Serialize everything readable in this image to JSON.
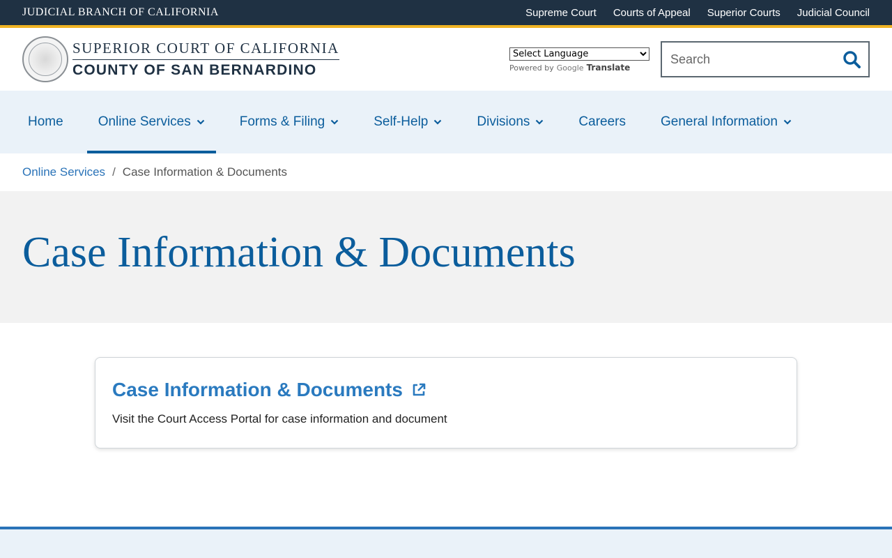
{
  "topbar": {
    "branch": "JUDICIAL BRANCH OF CALIFORNIA",
    "links": [
      "Supreme Court",
      "Courts of Appeal",
      "Superior Courts",
      "Judicial Council"
    ]
  },
  "header": {
    "logo_line1": "SUPERIOR COURT OF CALIFORNIA",
    "logo_line2": "COUNTY OF SAN BERNARDINO",
    "language_selected": "Select Language",
    "powered_by": "Powered by",
    "google": "Google",
    "translate": "Translate",
    "search_placeholder": "Search"
  },
  "nav": {
    "items": [
      {
        "label": "Home"
      },
      {
        "label": "Online Services"
      },
      {
        "label": "Forms & Filing"
      },
      {
        "label": "Self-Help"
      },
      {
        "label": "Divisions"
      },
      {
        "label": "Careers"
      },
      {
        "label": "General Information"
      }
    ]
  },
  "breadcrumb": {
    "parent": "Online Services",
    "separator": "/",
    "current": "Case Information & Documents"
  },
  "hero": {
    "title": "Case Information & Documents"
  },
  "card": {
    "title": "Case Information & Documents",
    "description": "Visit the Court Access Portal for case information and document"
  },
  "colors": {
    "topbar_bg": "#1f3143",
    "accent_gold": "#f0b323",
    "brand_blue": "#0b5d9c",
    "nav_bg": "#eaf2f9"
  }
}
